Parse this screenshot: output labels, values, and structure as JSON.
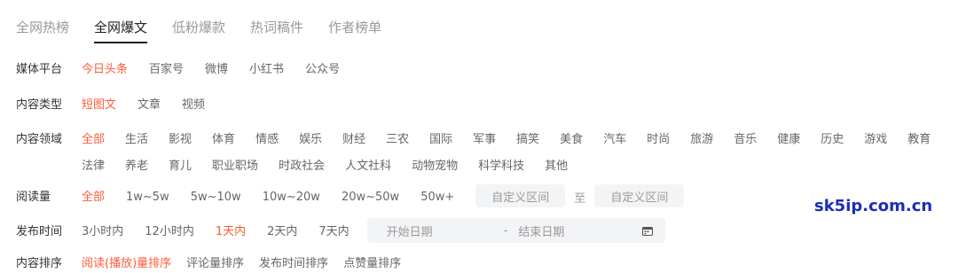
{
  "tabs": [
    "全网热榜",
    "全网爆文",
    "低粉爆款",
    "热词稿件",
    "作者榜单"
  ],
  "filters": {
    "platform": {
      "label": "媒体平台",
      "options": [
        "今日头条",
        "百家号",
        "微博",
        "小红书",
        "公众号"
      ]
    },
    "content_type": {
      "label": "内容类型",
      "options": [
        "短图文",
        "文章",
        "视频"
      ]
    },
    "domain": {
      "label": "内容领域",
      "options": [
        "全部",
        "生活",
        "影视",
        "体育",
        "情感",
        "娱乐",
        "财经",
        "三农",
        "国际",
        "军事",
        "搞笑",
        "美食",
        "汽车",
        "时尚",
        "旅游",
        "音乐",
        "健康",
        "历史",
        "游戏",
        "教育",
        "法律",
        "养老",
        "育儿",
        "职业职场",
        "时政社会",
        "人文社科",
        "动物宠物",
        "科学科技",
        "其他"
      ]
    },
    "reads": {
      "label": "阅读量",
      "options": [
        "全部",
        "1w~5w",
        "5w~10w",
        "10w~20w",
        "20w~50w",
        "50w+"
      ],
      "range_from_placeholder": "自定义区间",
      "range_to": "至",
      "range_to_placeholder": "自定义区间"
    },
    "publish_time": {
      "label": "发布时间",
      "options": [
        "3小时内",
        "12小时内",
        "1天内",
        "2天内",
        "7天内"
      ],
      "start_placeholder": "开始日期",
      "dash": "-",
      "end_placeholder": "结束日期"
    },
    "sort": {
      "label": "内容排序",
      "options": [
        "阅读(播放)量排序",
        "评论量排序",
        "发布时间排序",
        "点赞量排序"
      ]
    }
  },
  "watermark": "sk5ip.com.cn",
  "accent_color": "#ff5b3a"
}
